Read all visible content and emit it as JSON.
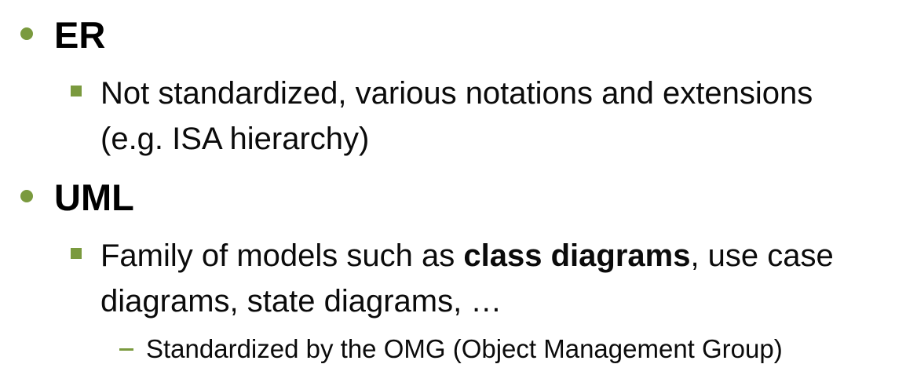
{
  "slide": {
    "items": [
      {
        "heading": "ER",
        "sub": {
          "line1": "Not standardized, various notations and extensions",
          "line2": "(e.g. ISA hierarchy)"
        }
      },
      {
        "heading": "UML",
        "sub": {
          "line1_before": "Family of models such as ",
          "line1_bold": "class diagrams",
          "line1_after": ", use case",
          "line2": "diagrams, state diagrams, …"
        },
        "subsub": "Standardized by the OMG (Object Management Group)"
      }
    ]
  },
  "colors": {
    "bullet": "#7a9a3e",
    "text": "#000000"
  },
  "icons": {
    "level1_bullet": "circle-bullet-icon",
    "level2_bullet": "square-bullet-icon",
    "level3_bullet": "dash-bullet-icon"
  }
}
